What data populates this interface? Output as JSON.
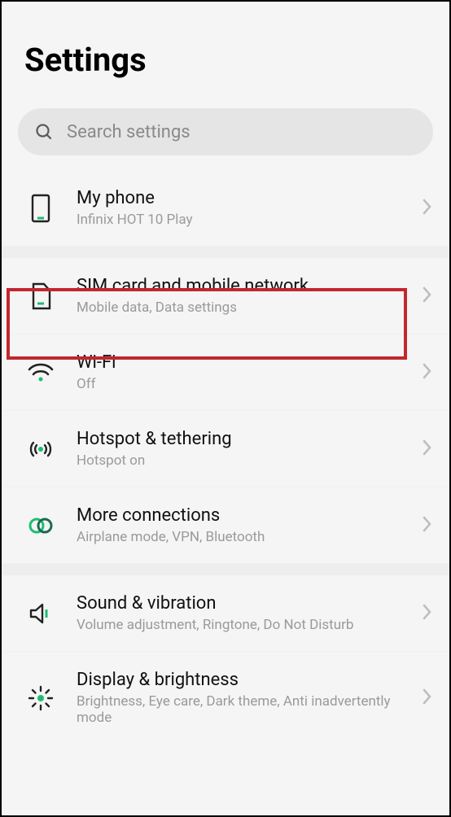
{
  "title": "Settings",
  "search": {
    "placeholder": "Search settings"
  },
  "items": [
    {
      "title": "My phone",
      "sub": "Infinix HOT 10 Play"
    },
    {
      "title": "SIM card and mobile network",
      "sub": "Mobile data, Data settings"
    },
    {
      "title": "Wi-Fi",
      "sub": "Off"
    },
    {
      "title": "Hotspot & tethering",
      "sub": "Hotspot on"
    },
    {
      "title": "More connections",
      "sub": "Airplane mode, VPN, Bluetooth"
    },
    {
      "title": "Sound & vibration",
      "sub": "Volume adjustment, Ringtone, Do Not Disturb"
    },
    {
      "title": "Display & brightness",
      "sub": "Brightness, Eye care, Dark theme, Anti inadvertently mode"
    }
  ]
}
